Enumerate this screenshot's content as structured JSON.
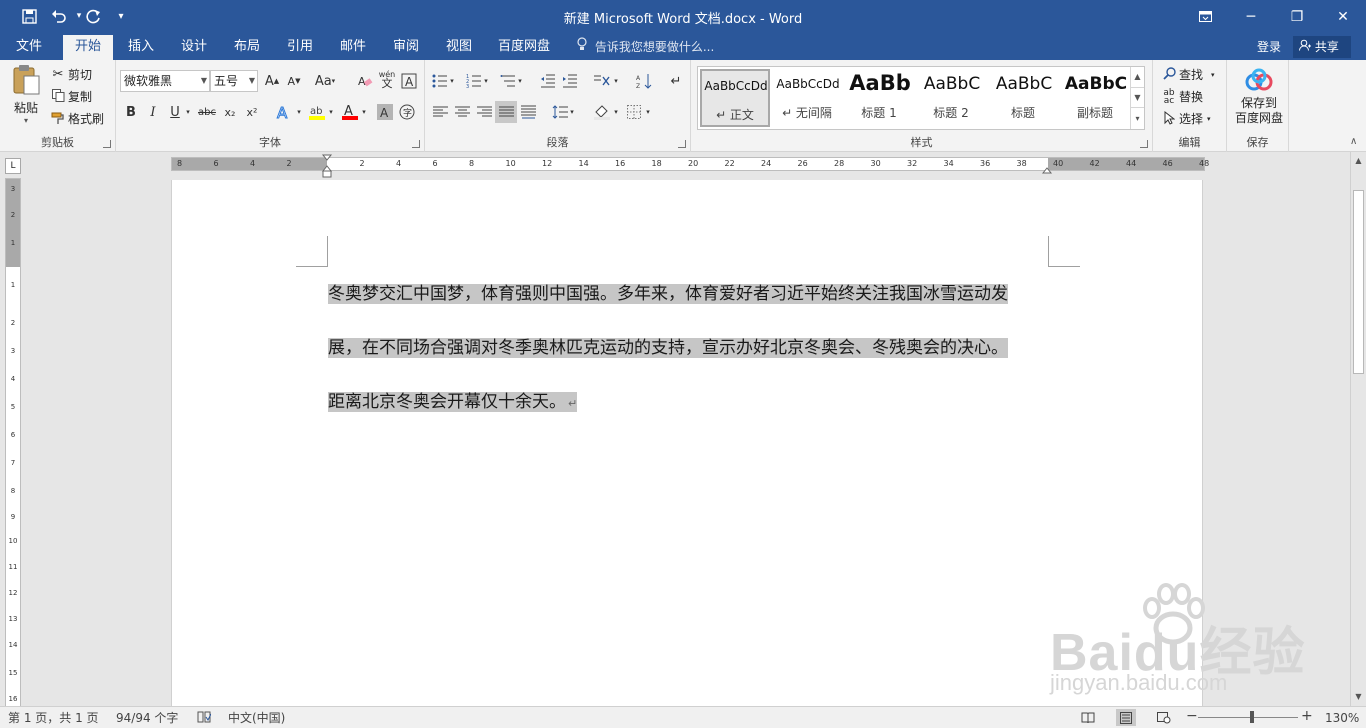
{
  "app": {
    "document_title": "新建 Microsoft Word 文档.docx - Word",
    "qat": {
      "save": "save-icon",
      "undo": "undo-icon",
      "redo": "redo-icon",
      "customize": "▾"
    }
  },
  "window_controls": {
    "ribbon_options": "ribbon-display-options-icon",
    "minimize": "─",
    "restore": "❐",
    "close": "✕"
  },
  "tabs": [
    {
      "label": "文件"
    },
    {
      "label": "开始"
    },
    {
      "label": "插入"
    },
    {
      "label": "设计"
    },
    {
      "label": "布局"
    },
    {
      "label": "引用"
    },
    {
      "label": "邮件"
    },
    {
      "label": "审阅"
    },
    {
      "label": "视图"
    },
    {
      "label": "百度网盘"
    }
  ],
  "active_tab": "开始",
  "tell_me": "告诉我您想要做什么...",
  "account": {
    "login": "登录",
    "share": "共享"
  },
  "ribbon": {
    "clipboard": {
      "label": "剪贴板",
      "paste": "粘贴",
      "cut": "剪切",
      "copy": "复制",
      "format_painter": "格式刷"
    },
    "font": {
      "label": "字体",
      "font_name": "微软雅黑",
      "font_size": "五号",
      "grow": "A",
      "shrink": "A",
      "change_case": "Aa",
      "bold": "B",
      "italic": "I",
      "underline": "U",
      "strike": "abc",
      "subscript": "x₂",
      "superscript": "x²",
      "pinyin": "wén",
      "pinyin_char": "文",
      "highlight_color": "#ffff00",
      "font_color": "#ff0000"
    },
    "paragraph": {
      "label": "段落"
    },
    "styles": {
      "label": "样式",
      "items": [
        {
          "sample": "AaBbCcDd",
          "name": "↵ 正文"
        },
        {
          "sample": "AaBbCcDd",
          "name": "↵ 无间隔"
        },
        {
          "sample": "AaBb",
          "name": "标题 1"
        },
        {
          "sample": "AaBbC",
          "name": "标题 2"
        },
        {
          "sample": "AaBbC",
          "name": "标题"
        },
        {
          "sample": "AaBbC",
          "name": "副标题"
        }
      ]
    },
    "editing": {
      "label": "编辑",
      "find": "查找",
      "replace": "替换",
      "select": "选择"
    },
    "save": {
      "label": "保存",
      "button_line1": "保存到",
      "button_line2": "百度网盘"
    }
  },
  "ruler": {
    "corner": "L",
    "numbers": [
      "8",
      "6",
      "4",
      "2",
      "2",
      "4",
      "6",
      "8",
      "10",
      "12",
      "14",
      "16",
      "18",
      "20",
      "22",
      "24",
      "26",
      "28",
      "30",
      "32",
      "34",
      "36",
      "38",
      "40",
      "42",
      "44",
      "46",
      "48"
    ],
    "vertical_numbers": [
      "3",
      "2",
      "1",
      "1",
      "2",
      "3",
      "4",
      "5",
      "6",
      "7",
      "8",
      "9",
      "10",
      "11",
      "12",
      "13",
      "14",
      "15",
      "16"
    ]
  },
  "document": {
    "lines": [
      "冬奥梦交汇中国梦，体育强则中国强。多年来，体育爱好者习近平始终关注我国冰雪运动发",
      "展，在不同场合强调对冬季奥林匹克运动的支持，宣示办好北京冬奥会、冬残奥会的决心。",
      "距离北京冬奥会开幕仅十余天。"
    ],
    "paragraph_mark": "↵",
    "selection_color": "#c6c6c6"
  },
  "watermark": {
    "main": "Baidu经验",
    "url": "jingyan.baidu.com"
  },
  "status": {
    "page": "第 1 页，共 1 页",
    "words": "94/94 个字",
    "proof_icon": "proofing-icon",
    "language": "中文(中国)",
    "zoom": "130%",
    "zoom_fraction": 0.54
  },
  "colors": {
    "brand": "#2b579a",
    "ribbon_bg": "#f3f3f3",
    "canvas": "#e6e6e6"
  }
}
